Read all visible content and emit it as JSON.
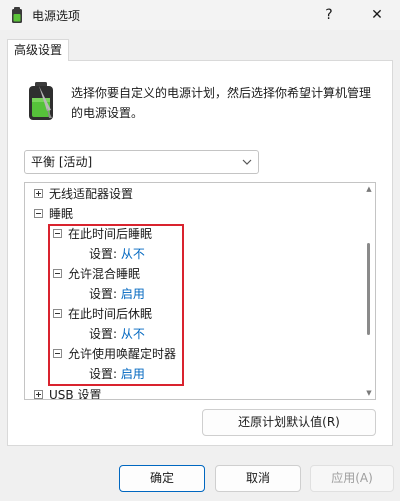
{
  "window": {
    "title": "电源选项",
    "help_label": "?",
    "close_label": "✕"
  },
  "tab": {
    "label": "高级设置"
  },
  "description": "选择你要自定义的电源计划，然后选择你希望计算机管理的电源设置。",
  "plan_select": {
    "value": "平衡 [活动]"
  },
  "tree": {
    "wireless": "无线适配器设置",
    "sleep": "睡眠",
    "sleep_after": {
      "label": "在此时间后睡眠",
      "setting_label": "设置:",
      "value": "从不"
    },
    "hybrid_sleep": {
      "label": "允许混合睡眠",
      "setting_label": "设置:",
      "value": "启用"
    },
    "hibernate_after": {
      "label": "在此时间后休眠",
      "setting_label": "设置:",
      "value": "从不"
    },
    "wake_timers": {
      "label": "允许使用唤醒定时器",
      "setting_label": "设置:",
      "value": "启用"
    },
    "usb": "USB 设置"
  },
  "buttons": {
    "restore": "还原计划默认值(R)",
    "ok": "确定",
    "cancel": "取消",
    "apply": "应用(A)"
  },
  "colors": {
    "accent": "#0067c0",
    "highlight_border": "#d9232e"
  }
}
